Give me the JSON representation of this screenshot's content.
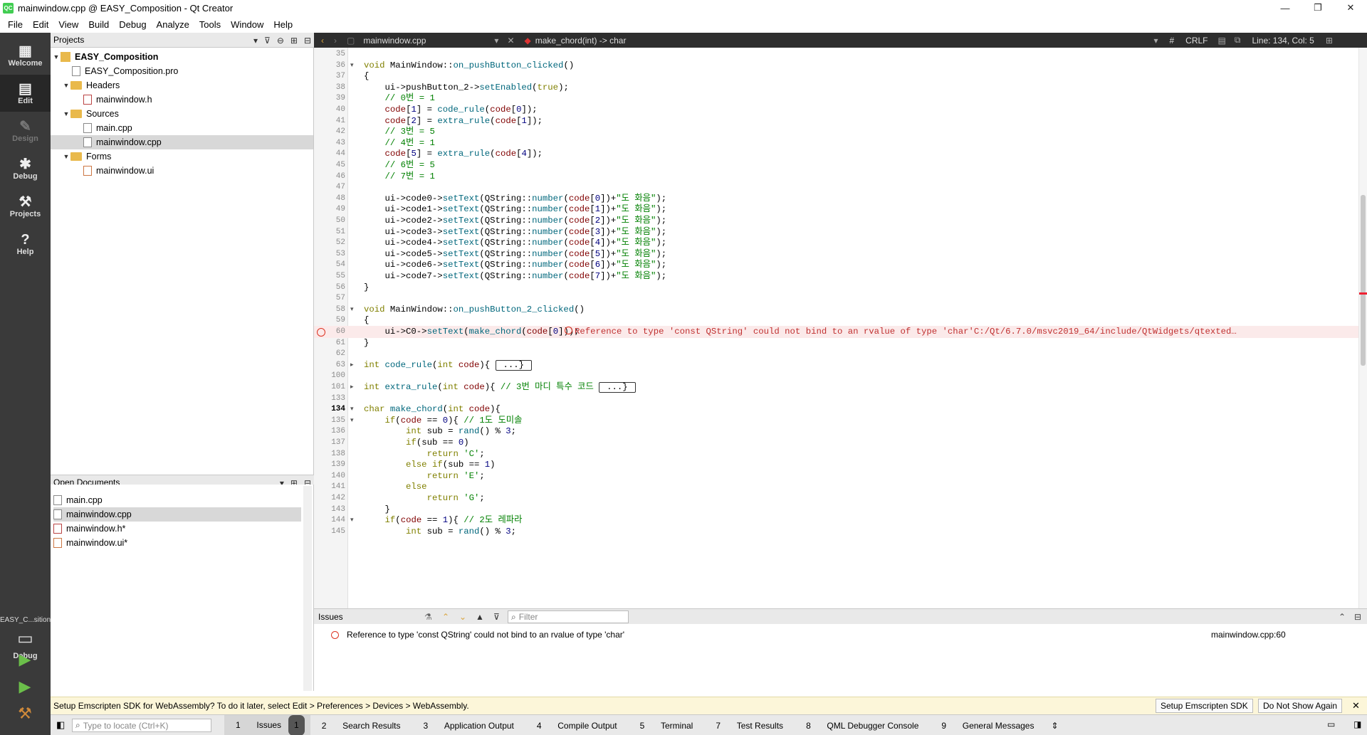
{
  "window": {
    "title": "mainwindow.cpp @ EASY_Composition - Qt Creator",
    "app_icon": "QC",
    "minimize": "—",
    "maximize": "❐",
    "close": "✕"
  },
  "menu": [
    "File",
    "Edit",
    "View",
    "Build",
    "Debug",
    "Analyze",
    "Tools",
    "Window",
    "Help"
  ],
  "modes": [
    {
      "label": "Welcome",
      "icon": "grid-icon"
    },
    {
      "label": "Edit",
      "icon": "edit-icon"
    },
    {
      "label": "Design",
      "icon": "design-icon"
    },
    {
      "label": "Debug",
      "icon": "bug-icon"
    },
    {
      "label": "Projects",
      "icon": "wrench-icon"
    },
    {
      "label": "Help",
      "icon": "help-icon"
    }
  ],
  "kit": {
    "name": "EASY_C...sition",
    "target": "Debug"
  },
  "projects": {
    "header": "Projects",
    "tree": [
      {
        "label": "EASY_Composition",
        "level": 0,
        "kind": "project",
        "expanded": true
      },
      {
        "label": "EASY_Composition.pro",
        "level": 1,
        "kind": "file"
      },
      {
        "label": "Headers",
        "level": 1,
        "kind": "folder",
        "expanded": true
      },
      {
        "label": "mainwindow.h",
        "level": 2,
        "kind": "header"
      },
      {
        "label": "Sources",
        "level": 1,
        "kind": "folder",
        "expanded": true
      },
      {
        "label": "main.cpp",
        "level": 2,
        "kind": "file"
      },
      {
        "label": "mainwindow.cpp",
        "level": 2,
        "kind": "file",
        "selected": true
      },
      {
        "label": "Forms",
        "level": 1,
        "kind": "folder",
        "expanded": true
      },
      {
        "label": "mainwindow.ui",
        "level": 2,
        "kind": "ui"
      }
    ]
  },
  "open_documents": {
    "header": "Open Documents",
    "items": [
      {
        "label": "main.cpp",
        "kind": "file"
      },
      {
        "label": "mainwindow.cpp",
        "kind": "file",
        "selected": true
      },
      {
        "label": "mainwindow.h*",
        "kind": "header"
      },
      {
        "label": "mainwindow.ui*",
        "kind": "ui"
      }
    ]
  },
  "editor_toolbar": {
    "file": "mainwindow.cpp",
    "symbol": "make_chord(int) -> char",
    "hash": "#",
    "line_ending": "CRLF",
    "position": "Line: 134, Col: 5"
  },
  "code_lines": [
    {
      "n": "35",
      "t": ""
    },
    {
      "n": "36",
      "t": "void MainWindow::on_pushButton_clicked()",
      "fold": "▾"
    },
    {
      "n": "37",
      "t": "{"
    },
    {
      "n": "38",
      "t": "    ui->pushButton_2->setEnabled(true);"
    },
    {
      "n": "39",
      "t": "    // 0번 = 1"
    },
    {
      "n": "40",
      "t": "    code[1] = code_rule(code[0]);"
    },
    {
      "n": "41",
      "t": "    code[2] = extra_rule(code[1]);"
    },
    {
      "n": "42",
      "t": "    // 3번 = 5"
    },
    {
      "n": "43",
      "t": "    // 4번 = 1"
    },
    {
      "n": "44",
      "t": "    code[5] = extra_rule(code[4]);"
    },
    {
      "n": "45",
      "t": "    // 6번 = 5"
    },
    {
      "n": "46",
      "t": "    // 7번 = 1"
    },
    {
      "n": "47",
      "t": ""
    },
    {
      "n": "48",
      "t": "    ui->code0->setText(QString::number(code[0])+\"도 화음\");"
    },
    {
      "n": "49",
      "t": "    ui->code1->setText(QString::number(code[1])+\"도 화음\");"
    },
    {
      "n": "50",
      "t": "    ui->code2->setText(QString::number(code[2])+\"도 화음\");"
    },
    {
      "n": "51",
      "t": "    ui->code3->setText(QString::number(code[3])+\"도 화음\");"
    },
    {
      "n": "52",
      "t": "    ui->code4->setText(QString::number(code[4])+\"도 화음\");"
    },
    {
      "n": "53",
      "t": "    ui->code5->setText(QString::number(code[5])+\"도 화음\");"
    },
    {
      "n": "54",
      "t": "    ui->code6->setText(QString::number(code[6])+\"도 화음\");"
    },
    {
      "n": "55",
      "t": "    ui->code7->setText(QString::number(code[7])+\"도 화음\");"
    },
    {
      "n": "56",
      "t": "}"
    },
    {
      "n": "57",
      "t": ""
    },
    {
      "n": "58",
      "t": "void MainWindow::on_pushButton_2_clicked()",
      "fold": "▾"
    },
    {
      "n": "59",
      "t": "{"
    },
    {
      "n": "60",
      "t": "    ui->C0->setText(make_chord(code[0]));",
      "error": "Reference to type 'const QString' could not bind to an rvalue of type 'char'C:/Qt/6.7.0/msvc2019_64/include/QtWidgets/qtexted…"
    },
    {
      "n": "61",
      "t": "}"
    },
    {
      "n": "62",
      "t": ""
    },
    {
      "n": "63",
      "t": "int code_rule(int code){ ",
      "fold": "▸",
      "box": "...}"
    },
    {
      "n": "100",
      "t": ""
    },
    {
      "n": "101",
      "t": "int extra_rule(int code){ // 3번 마디 특수 코드 ",
      "fold": "▸",
      "box": "...}"
    },
    {
      "n": "133",
      "t": ""
    },
    {
      "n": "134",
      "t": "char make_chord(int code){",
      "fold": "▾"
    },
    {
      "n": "135",
      "t": "    if(code == 0){ // 1도 도미솔",
      "fold": "▾"
    },
    {
      "n": "136",
      "t": "        int sub = rand() % 3;"
    },
    {
      "n": "137",
      "t": "        if(sub == 0)"
    },
    {
      "n": "138",
      "t": "            return 'C';"
    },
    {
      "n": "139",
      "t": "        else if(sub == 1)"
    },
    {
      "n": "140",
      "t": "            return 'E';"
    },
    {
      "n": "141",
      "t": "        else"
    },
    {
      "n": "142",
      "t": "            return 'G';"
    },
    {
      "n": "143",
      "t": "    }"
    },
    {
      "n": "144",
      "t": "    if(code == 1){ // 2도 레파라",
      "fold": "▾"
    },
    {
      "n": "145",
      "t": "        int sub = rand() % 3;"
    }
  ],
  "issues": {
    "header": "Issues",
    "filter_placeholder": "Filter",
    "items": [
      {
        "text": "Reference to type 'const QString' could not bind to an rvalue of type 'char'",
        "location": "mainwindow.cpp:60"
      }
    ]
  },
  "notice": {
    "text": "Setup Emscripten SDK for WebAssembly? To do it later, select Edit > Preferences > Devices > WebAssembly.",
    "setup_button": "Setup Emscripten SDK",
    "dismiss_button": "Do Not Show Again",
    "close": "✕"
  },
  "statusbar": {
    "locate_placeholder": "Type to locate (Ctrl+K)",
    "tabs": [
      {
        "num": "1",
        "label": "Issues",
        "badge": "1"
      },
      {
        "num": "2",
        "label": "Search Results"
      },
      {
        "num": "3",
        "label": "Application Output"
      },
      {
        "num": "4",
        "label": "Compile Output"
      },
      {
        "num": "5",
        "label": "Terminal"
      },
      {
        "num": "7",
        "label": "Test Results"
      },
      {
        "num": "8",
        "label": "QML Debugger Console"
      },
      {
        "num": "9",
        "label": "General Messages"
      }
    ]
  }
}
